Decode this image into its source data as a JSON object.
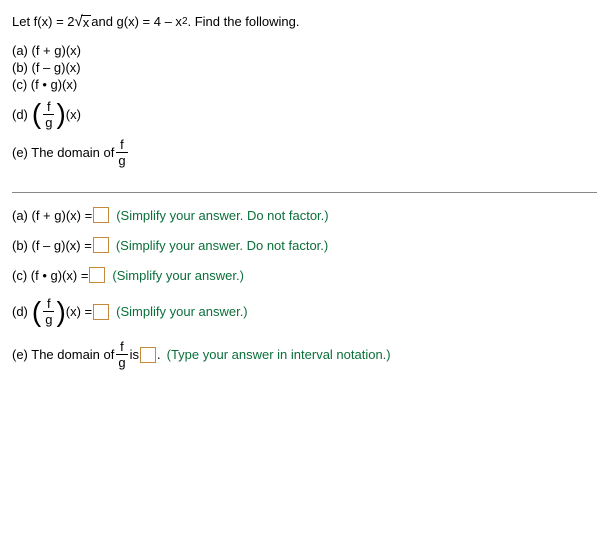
{
  "problem": {
    "intro_prefix": "Let f(x) = 2",
    "sqrt_arg": "x",
    "intro_mid": " and g(x) = 4 – x",
    "intro_suffix": ". Find the following.",
    "parts": {
      "a": "(a) (f + g)(x)",
      "b": "(b) (f – g)(x)",
      "c": "(c) (f • g)(x)",
      "d_label": "(d)",
      "d_after": "(x)",
      "e_prefix": "(e)  The domain of "
    },
    "frac": {
      "num": "f",
      "den": "g"
    }
  },
  "answers": {
    "a": {
      "lhs": "(a) (f + g)(x) = ",
      "hint": "(Simplify your answer. Do not factor.)"
    },
    "b": {
      "lhs": "(b) (f – g)(x) = ",
      "hint": "(Simplify your answer. Do not factor.)"
    },
    "c": {
      "lhs": "(c) (f • g)(x) = ",
      "hint": "(Simplify your answer.)"
    },
    "d": {
      "label": "(d)",
      "after": "(x) = ",
      "hint": "(Simplify your answer.)"
    },
    "e": {
      "prefix": "(e) The domain of ",
      "mid": " is ",
      "suffix": ".",
      "hint": "(Type your answer in interval notation.)"
    }
  }
}
